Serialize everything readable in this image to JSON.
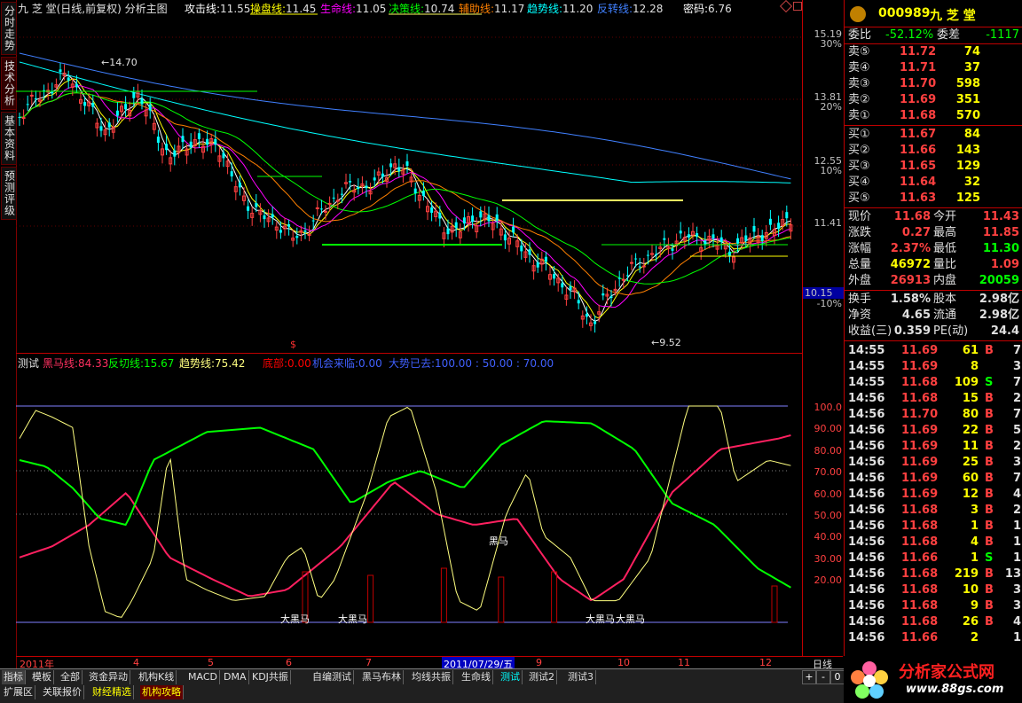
{
  "sidebar": {
    "tabs": [
      {
        "id": "fenshi",
        "label": "分时走势"
      },
      {
        "id": "jishu",
        "label": "技术分析"
      },
      {
        "id": "jiben",
        "label": "基本资料"
      },
      {
        "id": "yuce",
        "label": "预测评级"
      }
    ]
  },
  "main_header": {
    "title": "九 芝 堂(日线,前复权) 分析主图",
    "items": [
      {
        "label": "攻击线:",
        "value": "11.55",
        "color": "#ffffff"
      },
      {
        "label": "操盘线:",
        "value": "11.45",
        "color": "#ffff00"
      },
      {
        "label": "生命线:",
        "value": "11.05",
        "color": "#ff00ff"
      },
      {
        "label": "决策线:",
        "value": "10.74",
        "color": "#00ff00"
      },
      {
        "label": "辅助线:",
        "value": "11.17",
        "color": "#ff8000"
      },
      {
        "label": "趋势线:",
        "value": "11.20",
        "color": "#00ffff"
      },
      {
        "label": "反转线:",
        "value": "12.28",
        "color": "#4080ff"
      },
      {
        "label": "密码:",
        "value": "6.76",
        "color": "#ffffff"
      }
    ]
  },
  "main_annotations": {
    "high": "←14.70",
    "low": "←9.52",
    "marker": "$"
  },
  "main_yaxis": [
    {
      "label": "15.19",
      "color": "#ff4040"
    },
    {
      "label": "30%",
      "color": "#ff4040"
    },
    {
      "label": "13.81",
      "color": "#ff4040"
    },
    {
      "label": "20%",
      "color": "#ff4040"
    },
    {
      "label": "12.55",
      "color": "#ff4040"
    },
    {
      "label": "10%",
      "color": "#ff4040"
    },
    {
      "label": "11.41",
      "color": "#ff4040"
    },
    {
      "label": "10.15",
      "color": "#ffffff"
    },
    {
      "label": "-10%",
      "color": "#00c000"
    }
  ],
  "sub_header": {
    "title": "测试",
    "items": [
      {
        "label": "黑马线:",
        "value": "84.33",
        "color": "#ff3060"
      },
      {
        "label": "反切线:",
        "value": "15.67",
        "color": "#00ff00"
      },
      {
        "label": "趋势线:",
        "value": "75.42",
        "color": "#ffff80"
      },
      {
        "label": "底部:",
        "value": "0.00",
        "color": "#ff0000"
      },
      {
        "label": "机会来临:",
        "value": "0.00",
        "color": "#4060ff"
      },
      {
        "label": "大势已去:",
        "value": "100.00 : 50.00 : 70.00",
        "color": "#4060ff"
      }
    ],
    "last": "70.00"
  },
  "sub_annotations": [
    "大黑马",
    "大黑马",
    "黑马",
    "大黑马",
    "大黑马"
  ],
  "sub_yaxis": [
    "100.0",
    "90.00",
    "80.00",
    "70.00",
    "60.00",
    "50.00",
    "40.00",
    "30.00",
    "20.00"
  ],
  "date_axis": {
    "labels": [
      "2011年",
      "4",
      "5",
      "6",
      "7",
      "2011/07/29/五",
      "9",
      "10",
      "11",
      "12"
    ],
    "period": "日线"
  },
  "quote": {
    "code": "000989",
    "name": "九 芝 堂",
    "weibi_label": "委比",
    "weibi": "-52.12%",
    "weicha_label": "委差",
    "weicha": "-1117",
    "sell": [
      {
        "label": "卖⑤",
        "price": "11.72",
        "vol": "74"
      },
      {
        "label": "卖④",
        "price": "11.71",
        "vol": "37"
      },
      {
        "label": "卖③",
        "price": "11.70",
        "vol": "598"
      },
      {
        "label": "卖②",
        "price": "11.69",
        "vol": "351"
      },
      {
        "label": "卖①",
        "price": "11.68",
        "vol": "570"
      }
    ],
    "buy": [
      {
        "label": "买①",
        "price": "11.67",
        "vol": "84"
      },
      {
        "label": "买②",
        "price": "11.66",
        "vol": "143"
      },
      {
        "label": "买③",
        "price": "11.65",
        "vol": "129"
      },
      {
        "label": "买④",
        "price": "11.64",
        "vol": "32"
      },
      {
        "label": "买⑤",
        "price": "11.63",
        "vol": "125"
      }
    ],
    "stats": [
      {
        "l1": "现价",
        "v1": "11.68",
        "c1": "#ff4040",
        "l2": "今开",
        "v2": "11.43",
        "c2": "#ff4040"
      },
      {
        "l1": "涨跌",
        "v1": "0.27",
        "c1": "#ff4040",
        "l2": "最高",
        "v2": "11.85",
        "c2": "#ff4040"
      },
      {
        "l1": "涨幅",
        "v1": "2.37%",
        "c1": "#ff4040",
        "l2": "最低",
        "v2": "11.30",
        "c2": "#00ff00"
      },
      {
        "l1": "总量",
        "v1": "46972",
        "c1": "#ffff00",
        "l2": "量比",
        "v2": "1.09",
        "c2": "#ff4040"
      },
      {
        "l1": "外盘",
        "v1": "26913",
        "c1": "#ff4040",
        "l2": "内盘",
        "v2": "20059",
        "c2": "#00ff00"
      },
      {
        "l1": "换手",
        "v1": "1.58%",
        "c1": "#e0e0e0",
        "l2": "股本",
        "v2": "2.98亿",
        "c2": "#e0e0e0"
      },
      {
        "l1": "净资",
        "v1": "4.65",
        "c1": "#e0e0e0",
        "l2": "流通",
        "v2": "2.98亿",
        "c2": "#e0e0e0"
      },
      {
        "l1": "收益(三)",
        "v1": "0.359",
        "c1": "#e0e0e0",
        "l2": "PE(动)",
        "v2": "24.4",
        "c2": "#e0e0e0"
      }
    ]
  },
  "ticks": [
    {
      "time": "14:55",
      "price": "11.69",
      "vol": "61",
      "bs": "B",
      "n": "7"
    },
    {
      "time": "14:55",
      "price": "11.69",
      "vol": "8",
      "bs": "",
      "n": "3"
    },
    {
      "time": "14:55",
      "price": "11.68",
      "vol": "109",
      "bs": "S",
      "n": "7"
    },
    {
      "time": "14:56",
      "price": "11.68",
      "vol": "15",
      "bs": "B",
      "n": "2"
    },
    {
      "time": "14:56",
      "price": "11.70",
      "vol": "80",
      "bs": "B",
      "n": "7"
    },
    {
      "time": "14:56",
      "price": "11.69",
      "vol": "22",
      "bs": "B",
      "n": "5"
    },
    {
      "time": "14:56",
      "price": "11.69",
      "vol": "11",
      "bs": "B",
      "n": "2"
    },
    {
      "time": "14:56",
      "price": "11.69",
      "vol": "25",
      "bs": "B",
      "n": "3"
    },
    {
      "time": "14:56",
      "price": "11.69",
      "vol": "60",
      "bs": "B",
      "n": "7"
    },
    {
      "time": "14:56",
      "price": "11.69",
      "vol": "12",
      "bs": "B",
      "n": "4"
    },
    {
      "time": "14:56",
      "price": "11.68",
      "vol": "3",
      "bs": "B",
      "n": "2"
    },
    {
      "time": "14:56",
      "price": "11.68",
      "vol": "1",
      "bs": "B",
      "n": "1"
    },
    {
      "time": "14:56",
      "price": "11.68",
      "vol": "4",
      "bs": "B",
      "n": "1"
    },
    {
      "time": "14:56",
      "price": "11.66",
      "vol": "1",
      "bs": "S",
      "n": "1"
    },
    {
      "time": "14:56",
      "price": "11.68",
      "vol": "219",
      "bs": "B",
      "n": "13"
    },
    {
      "time": "14:56",
      "price": "11.68",
      "vol": "10",
      "bs": "B",
      "n": "3"
    },
    {
      "time": "14:56",
      "price": "11.68",
      "vol": "9",
      "bs": "B",
      "n": "3"
    },
    {
      "time": "14:56",
      "price": "11.68",
      "vol": "26",
      "bs": "B",
      "n": "4"
    },
    {
      "time": "14:56",
      "price": "11.66",
      "vol": "2",
      "bs": "",
      "n": "1"
    }
  ],
  "bottom_tabs": [
    "指标",
    "模板",
    "全部",
    "资金异动",
    "机构K线",
    "MACD",
    "DMA",
    "KDJ共振",
    "自编测试",
    "黑马布林",
    "均线共振",
    "生命线",
    "测试",
    "测试2",
    "测试3"
  ],
  "bottom_tabs2": [
    "扩展区",
    "关联报价",
    "财经精选",
    "机构攻略"
  ],
  "controls": [
    "+",
    "-",
    "0"
  ],
  "logo": {
    "title": "分析家公式网",
    "url": "www.88gs.com"
  },
  "colors": {
    "up": "#ff4040",
    "down": "#00ffff",
    "accent": "#c00000"
  }
}
